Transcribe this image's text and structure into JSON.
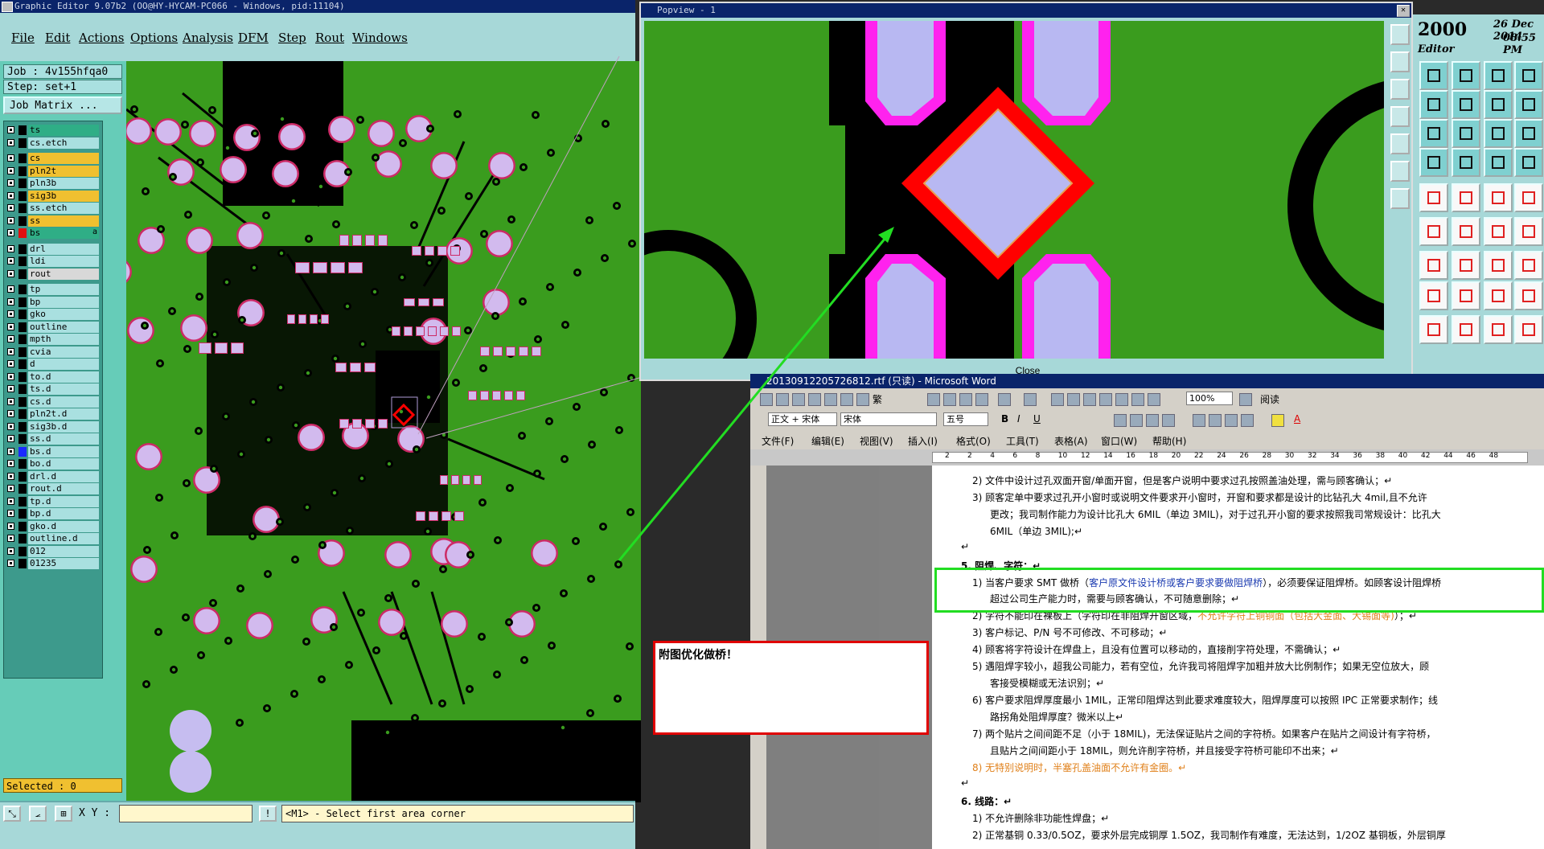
{
  "ge": {
    "title": "Graphic Editor 9.07b2 (OO@HY-HYCAM-PC066 - Windows, pid:11104)",
    "menu": [
      "File",
      "Edit",
      "Actions",
      "Options",
      "Analysis",
      "DFM",
      "Step",
      "Rout",
      "Windows"
    ],
    "job": "Job : 4v155hfqa0",
    "step": "Step: set+1",
    "job_matrix": "Job Matrix ...",
    "layers": [
      {
        "name": "ts",
        "color": "#2fae86",
        "swatch": "#000000"
      },
      {
        "name": "cs.etch",
        "color": "#a9e0e0",
        "swatch": "#000000"
      },
      {
        "name": "cs",
        "color": "#f0c030",
        "swatch": "#000000"
      },
      {
        "name": "pln2t",
        "color": "#f0c030",
        "swatch": "#000000"
      },
      {
        "name": "pln3b",
        "color": "#a9e0e0",
        "swatch": "#000000"
      },
      {
        "name": "sig3b",
        "color": "#f0c030",
        "swatch": "#000000"
      },
      {
        "name": "ss.etch",
        "color": "#a9e0e0",
        "swatch": "#000000"
      },
      {
        "name": "ss",
        "color": "#f0c030",
        "swatch": "#000000"
      },
      {
        "name": "bs",
        "color": "#2fae86",
        "swatch": "#e01010"
      },
      {
        "name": "drl",
        "color": "#a9e0e0",
        "swatch": "#000000"
      },
      {
        "name": "ldi",
        "color": "#a9e0e0",
        "swatch": "#000000"
      },
      {
        "name": "rout",
        "color": "#d8d8d8",
        "swatch": "#000000"
      },
      {
        "name": "tp",
        "color": "#a9e0e0",
        "swatch": "#000000"
      },
      {
        "name": "bp",
        "color": "#a9e0e0",
        "swatch": "#000000"
      },
      {
        "name": "gko",
        "color": "#a9e0e0",
        "swatch": "#000000"
      },
      {
        "name": "outline",
        "color": "#a9e0e0",
        "swatch": "#000000"
      },
      {
        "name": "mpth",
        "color": "#a9e0e0",
        "swatch": "#000000"
      },
      {
        "name": "cvia",
        "color": "#a9e0e0",
        "swatch": "#000000"
      },
      {
        "name": "d",
        "color": "#a9e0e0",
        "swatch": "#000000"
      },
      {
        "name": "to.d",
        "color": "#a9e0e0",
        "swatch": "#000000"
      },
      {
        "name": "ts.d",
        "color": "#a9e0e0",
        "swatch": "#000000"
      },
      {
        "name": "cs.d",
        "color": "#a9e0e0",
        "swatch": "#000000"
      },
      {
        "name": "pln2t.d",
        "color": "#a9e0e0",
        "swatch": "#000000"
      },
      {
        "name": "sig3b.d",
        "color": "#a9e0e0",
        "swatch": "#000000"
      },
      {
        "name": "ss.d",
        "color": "#a9e0e0",
        "swatch": "#000000"
      },
      {
        "name": "bs.d",
        "color": "#a9e0e0",
        "swatch": "#1a2aff"
      },
      {
        "name": "bo.d",
        "color": "#a9e0e0",
        "swatch": "#000000"
      },
      {
        "name": "drl.d",
        "color": "#a9e0e0",
        "swatch": "#000000"
      },
      {
        "name": "rout.d",
        "color": "#a9e0e0",
        "swatch": "#000000"
      },
      {
        "name": "tp.d",
        "color": "#a9e0e0",
        "swatch": "#000000"
      },
      {
        "name": "bp.d",
        "color": "#a9e0e0",
        "swatch": "#000000"
      },
      {
        "name": "gko.d",
        "color": "#a9e0e0",
        "swatch": "#000000"
      },
      {
        "name": "outline.d",
        "color": "#a9e0e0",
        "swatch": "#000000"
      },
      {
        "name": "012",
        "color": "#a9e0e0",
        "swatch": "#000000"
      },
      {
        "name": "01235",
        "color": "#a9e0e0",
        "swatch": "#000000"
      }
    ],
    "bs_flag": "a",
    "selected": "Selected : 0",
    "xy_label": "X Y :",
    "status": "<M1> - Select first area corner"
  },
  "popview": {
    "title": "Popview - 1",
    "close": "Close"
  },
  "clock": {
    "year": "2000",
    "date": "26 Dec 2014",
    "time": "08:55 PM",
    "sub": "Editor"
  },
  "word": {
    "title": "20130912205726812.rtf (只读) - Microsoft Word",
    "style": "正文 + 宋体",
    "font": "宋体",
    "size": "五号",
    "zoom": "100%",
    "read": "阅读",
    "menu": [
      "文件(F)",
      "编辑(E)",
      "视图(V)",
      "插入(I)",
      "格式(O)",
      "工具(T)",
      "表格(A)",
      "窗口(W)",
      "帮助(H)"
    ],
    "ruler": [
      "2",
      "2",
      "4",
      "6",
      "8",
      "10",
      "12",
      "14",
      "16",
      "18",
      "20",
      "22",
      "24",
      "26",
      "28",
      "30",
      "32",
      "34",
      "36",
      "38",
      "40",
      "42",
      "44",
      "46",
      "48"
    ],
    "lines": [
      {
        "t": "2) 文件中设计过孔双面开窗/单面开窗，但是客户说明中要求过孔按照盖油处理，需与顾客确认；↵"
      },
      {
        "t": "3) 顾客定单中要求过孔开小窗时或说明文件要求开小窗时，开窗和要求都是设计的比钻孔大 4mil,且不允许"
      },
      {
        "t": "更改；我司制作能力为设计比孔大 6MIL（单边 3MIL)，对于过孔开小窗的要求按照我司常规设计：比孔大"
      },
      {
        "t": "6MIL（单边 3MIL);↵"
      },
      {
        "t": "↵"
      },
      {
        "t": "5. 阻焊、字符：↵"
      },
      {
        "t": "1) 当客户要求 SMT 做桥（"
      },
      {
        "t": "客户原文件设计桥或客户要求要做阻焊桥"
      },
      {
        "t": "），必须要保证阻焊桥。如顾客设计阻焊桥"
      },
      {
        "t": "超过公司生产能力时，需要与顾客确认，不可随意删除；↵"
      },
      {
        "t": "2) 字符不能印在裸板上（字符印在非阻焊开窗区域，"
      },
      {
        "t": "不允许字符上铜铜面（包括大金面、大锡面等)"
      },
      {
        "t": "）；↵"
      },
      {
        "t": "3) 客户标记、P/N 号不可修改、不可移动；↵"
      },
      {
        "t": "4) 顾客将字符设计在焊盘上，且没有位置可以移动的，直接削字符处理，不需确认；↵"
      },
      {
        "t": "5) 遇阻焊字较小，超我公司能力，若有空位，允许我司将阻焊字加粗并放大比例制作；如果无空位放大，顾"
      },
      {
        "t": "客接受模糊或无法识别；↵"
      },
      {
        "t": "6) 客户要求阻焊厚度最小 1MIL，正常印阻焊达到此要求难度较大，阻焊厚度可以按照 IPC 正常要求制作；线"
      },
      {
        "t": "路拐角处阻焊厚度？微米以上↵"
      },
      {
        "t": "7) 两个贴片之间间距不足（小于 18MIL)，无法保证贴片之间的字符桥。如果客户在贴片之间设计有字符桥，"
      },
      {
        "t": "且贴片之间间距小于 18MIL，则允许削字符桥，并且接受字符桥可能印不出来；↵"
      },
      {
        "t": "8) 无特别说明时，半塞孔盖油面不允许有金圈。↵"
      },
      {
        "t": "↵"
      },
      {
        "t": "6. 线路：↵"
      },
      {
        "t": "1) 不允许删除非功能性焊盘；↵"
      },
      {
        "t": "2) 正常基铜 0.33/0.5OZ，要求外层完成铜厚 1.5OZ，我司制作有难度，无法达到，1/2OZ 基铜板，外层铜厚"
      }
    ]
  },
  "callout": "附图优化做桥！"
}
